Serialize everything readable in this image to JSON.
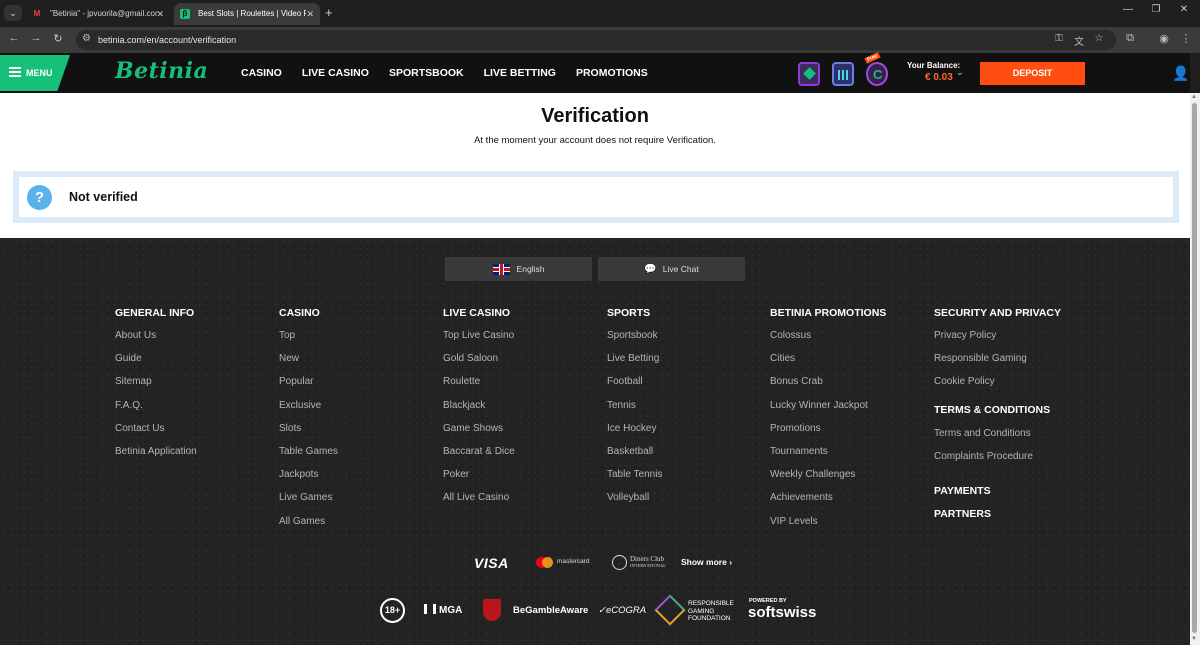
{
  "browser": {
    "tabs": [
      {
        "title": "\"Betinia\" - jpvuorila@gmail.com",
        "favicon": "gmail-icon"
      },
      {
        "title": "Best Slots | Roulettes | Video Po",
        "favicon": "betinia-icon"
      }
    ],
    "url": "betinia.com/en/account/verification"
  },
  "header": {
    "menu_label": "MENU",
    "logo_text": "Betinia",
    "nav": [
      "CASINO",
      "LIVE CASINO",
      "SPORTSBOOK",
      "LIVE BETTING",
      "PROMOTIONS"
    ],
    "balance_label": "Your Balance:",
    "balance_value": "€ 0.03",
    "deposit_label": "DEPOSIT",
    "promo_badge": "Free"
  },
  "content": {
    "title": "Verification",
    "subtitle": "At the moment your account does not require Verification.",
    "status": "Not verified"
  },
  "footer": {
    "language_label": "English",
    "chat_label": "Live Chat",
    "columns": [
      {
        "heading": "GENERAL INFO",
        "links": [
          "About Us",
          "Guide",
          "Sitemap",
          "F.A.Q.",
          "Contact Us",
          "Betinia Application"
        ]
      },
      {
        "heading": "CASINO",
        "links": [
          "Top",
          "New",
          "Popular",
          "Exclusive",
          "Slots",
          "Table Games",
          "Jackpots",
          "Live Games",
          "All Games"
        ]
      },
      {
        "heading": "LIVE CASINO",
        "links": [
          "Top Live Casino",
          "Gold Saloon",
          "Roulette",
          "Blackjack",
          "Game Shows",
          "Baccarat & Dice",
          "Poker",
          "All Live Casino"
        ]
      },
      {
        "heading": "SPORTS",
        "links": [
          "Sportsbook",
          "Live Betting",
          "Football",
          "Tennis",
          "Ice Hockey",
          "Basketball",
          "Table Tennis",
          "Volleyball"
        ]
      },
      {
        "heading": "BETINIA PROMOTIONS",
        "links": [
          "Colossus",
          "Cities",
          "Bonus Crab",
          "Lucky Winner Jackpot",
          "Promotions",
          "Tournaments",
          "Weekly Challenges",
          "Achievements",
          "VIP Levels"
        ]
      }
    ],
    "security": {
      "heading": "SECURITY AND PRIVACY",
      "links": [
        "Privacy Policy",
        "Responsible Gaming",
        "Cookie Policy"
      ],
      "terms_heading": "TERMS & CONDITIONS",
      "terms_links": [
        "Terms and Conditions",
        "Complaints Procedure"
      ],
      "payments_heading": "PAYMENTS",
      "partners_heading": "PARTNERS"
    },
    "payments": {
      "visa": "VISA",
      "mastercard": "mastercard",
      "diners": "Diners Club",
      "diners_sub": "INTERNATIONAL",
      "show_more": "Show more"
    },
    "regulators": {
      "age": "18+",
      "mga": "MGA",
      "gamble_aware": "BeGambleAware",
      "ecogra": "eCOGRA",
      "rgf_1": "RESPONSIBLE",
      "rgf_2": "GAMING",
      "rgf_3": "FOUNDATION",
      "powered_by": "POWERED BY",
      "provider": "softswiss"
    }
  }
}
